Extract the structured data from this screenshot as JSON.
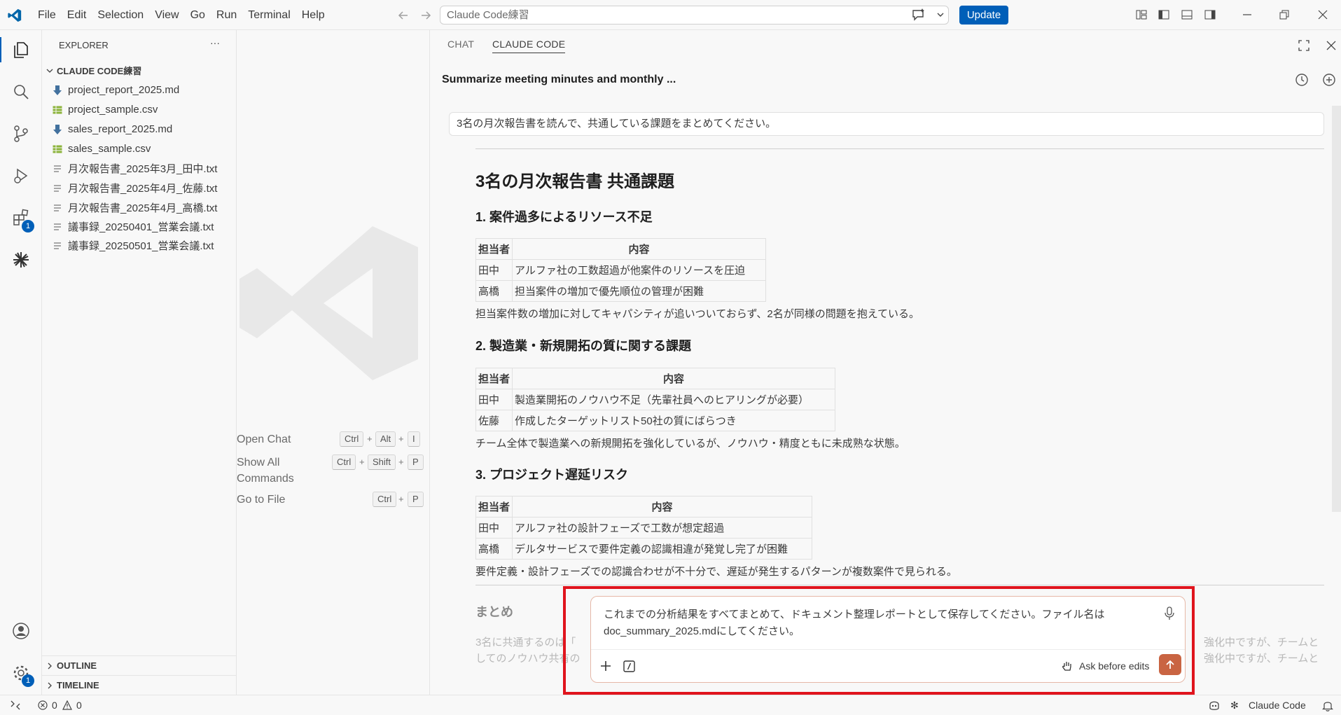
{
  "titlebar": {
    "menus": [
      "File",
      "Edit",
      "Selection",
      "View",
      "Go",
      "Run",
      "Terminal",
      "Help"
    ],
    "search_text": "Claude Code練習",
    "update_label": "Update"
  },
  "activity": {
    "extensions_badge": "1",
    "settings_badge": "1"
  },
  "sidebar": {
    "title": "EXPLORER",
    "more": "···",
    "folder": "CLAUDE CODE練習",
    "files": [
      {
        "name": "project_report_2025.md",
        "icon": "markdown-icon"
      },
      {
        "name": "project_sample.csv",
        "icon": "csv-icon"
      },
      {
        "name": "sales_report_2025.md",
        "icon": "markdown-icon"
      },
      {
        "name": "sales_sample.csv",
        "icon": "csv-icon"
      },
      {
        "name": "月次報告書_2025年3月_田中.txt",
        "icon": "text-file-icon"
      },
      {
        "name": "月次報告書_2025年4月_佐藤.txt",
        "icon": "text-file-icon"
      },
      {
        "name": "月次報告書_2025年4月_高橋.txt",
        "icon": "text-file-icon"
      },
      {
        "name": "議事録_20250401_営業会議.txt",
        "icon": "text-file-icon"
      },
      {
        "name": "議事録_20250501_営業会議.txt",
        "icon": "text-file-icon"
      }
    ],
    "outline": "OUTLINE",
    "timeline": "TIMELINE"
  },
  "welcome": {
    "open_chat": "Open Chat",
    "open_chat_keys": [
      "Ctrl",
      "Alt",
      "I"
    ],
    "show_all_1": "Show All",
    "show_all_2": "Commands",
    "show_all_keys": [
      "Ctrl",
      "Shift",
      "P"
    ],
    "go_to_file": "Go to File",
    "go_to_file_keys": [
      "Ctrl",
      "P"
    ],
    "plus": "+"
  },
  "panel": {
    "tabs": [
      "CHAT",
      "CLAUDE CODE"
    ],
    "session_title": "Summarize meeting minutes and monthly ...",
    "prompt": "3名の月次報告書を読んで、共通している課題をまとめてください。",
    "h1": "3名の月次報告書 共通課題",
    "sections": [
      {
        "heading": "1. 案件過多によるリソース不足",
        "headers": [
          "担当者",
          "内容"
        ],
        "rows": [
          [
            "田中",
            "アルファ社の工数超過が他案件のリソースを圧迫"
          ],
          [
            "高橋",
            "担当案件の増加で優先順位の管理が困難"
          ]
        ],
        "summary": "担当案件数の増加に対してキャパシティが追いついておらず、2名が同様の問題を抱えている。"
      },
      {
        "heading": "2. 製造業・新規開拓の質に関する課題",
        "headers": [
          "担当者",
          "内容"
        ],
        "rows": [
          [
            "田中",
            "製造業開拓のノウハウ不足（先輩社員へのヒアリングが必要）"
          ],
          [
            "佐藤",
            "作成したターゲットリスト50社の質にばらつき"
          ]
        ],
        "summary": "チーム全体で製造業への新規開拓を強化しているが、ノウハウ・精度ともに未成熟な状態。"
      },
      {
        "heading": "3. プロジェクト遅延リスク",
        "headers": [
          "担当者",
          "内容"
        ],
        "rows": [
          [
            "田中",
            "アルファ社の設計フェーズで工数が想定超過"
          ],
          [
            "高橋",
            "デルタサービスで要件定義の認識相違が発覚し完了が困難"
          ]
        ],
        "summary": "要件定義・設計フェーズでの認識合わせが不十分で、遅延が発生するパターンが複数案件で見られる。"
      }
    ],
    "matome": "まとめ",
    "faded_left": "3名に共通するのは「",
    "faded_left2": "してのノウハウ共有の",
    "faded_right": "強化中ですが、チームと",
    "input_text": "これまでの分析結果をすべてまとめて、ドキュメント整理レポートとして保存してください。ファイル名はdoc_summary_2025.mdにしてください。",
    "mode_label": "Ask before edits"
  },
  "statusbar": {
    "errors": "0",
    "warnings": "0",
    "claude": "Claude Code"
  }
}
